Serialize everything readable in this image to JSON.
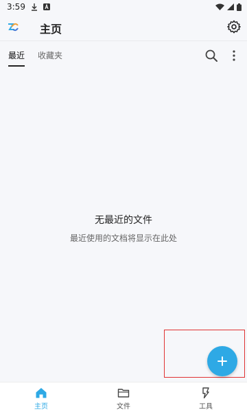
{
  "status_bar": {
    "time": "3:59"
  },
  "app_bar": {
    "title": "主页"
  },
  "tabs": [
    {
      "label": "最近",
      "active": true
    },
    {
      "label": "收藏夹",
      "active": false
    }
  ],
  "empty_state": {
    "title": "无最近的文件",
    "subtitle": "最近使用的文档将显示在此处"
  },
  "fab": {
    "icon": "plus-icon",
    "color": "#2ea9e5"
  },
  "bottom_nav": [
    {
      "label": "主页",
      "icon": "home-icon",
      "active": true
    },
    {
      "label": "文件",
      "icon": "folder-icon",
      "active": false
    },
    {
      "label": "工具",
      "icon": "tools-icon",
      "active": false
    }
  ],
  "colors": {
    "accent": "#2ea9e5",
    "background": "#f6f7fa",
    "highlight": "#e03131"
  }
}
